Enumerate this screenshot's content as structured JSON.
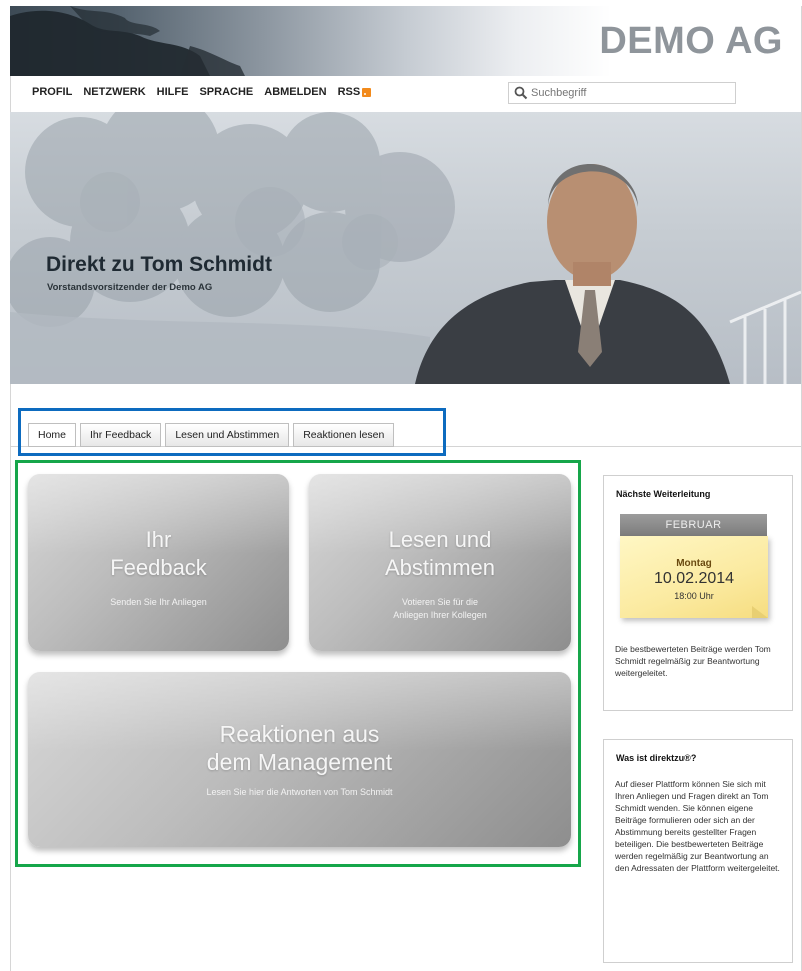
{
  "header": {
    "logo": "DEMO AG"
  },
  "nav": {
    "items": [
      "PROFIL",
      "NETZWERK",
      "HILFE",
      "SPRACHE",
      "ABMELDEN"
    ],
    "rss": "RSS"
  },
  "search": {
    "placeholder": "Suchbegriff"
  },
  "hero": {
    "title": "Direkt zu Tom Schmidt",
    "subtitle": "Vorstandsvorsitzender der Demo AG"
  },
  "tabs": [
    "Home",
    "Ihr Feedback",
    "Lesen und Abstimmen",
    "Reaktionen lesen"
  ],
  "tiles": [
    {
      "title_line1": "Ihr",
      "title_line2": "Feedback",
      "sub_line1": "Senden Sie Ihr Anliegen",
      "sub_line2": ""
    },
    {
      "title_line1": "Lesen und",
      "title_line2": "Abstimmen",
      "sub_line1": "Votieren Sie für die",
      "sub_line2": "Anliegen Ihrer Kollegen"
    },
    {
      "title_line1": "Reaktionen aus",
      "title_line2": "dem Management",
      "sub_line1": "Lesen Sie hier die Antworten von Tom Schmidt",
      "sub_line2": ""
    }
  ],
  "sidebar": {
    "next": {
      "heading": "Nächste Weiterleitung",
      "month": "FEBRUAR",
      "day": "Montag",
      "date": "10.02.2014",
      "time": "18:00 Uhr",
      "text": "Die bestbewerteten Beiträge werden Tom Schmidt regelmäßig zur Beantwortung weitergeleitet."
    },
    "about": {
      "heading": "Was ist direktzu®?",
      "text": "Auf dieser Plattform können Sie sich mit Ihren Anliegen und Fragen direkt an Tom Schmidt wenden. Sie können eigene Beiträge formulieren oder sich an der Abstimmung bereits gestellter Fragen beteiligen. Die bestbewerteten Beiträge werden regelmäßig zur Beantwortung an den Adressaten der Plattform weitergeleitet."
    }
  },
  "colors": {
    "tabs_highlight": "#0d6bbf",
    "tiles_highlight": "#16a64a",
    "rss": "#f28a1b"
  }
}
